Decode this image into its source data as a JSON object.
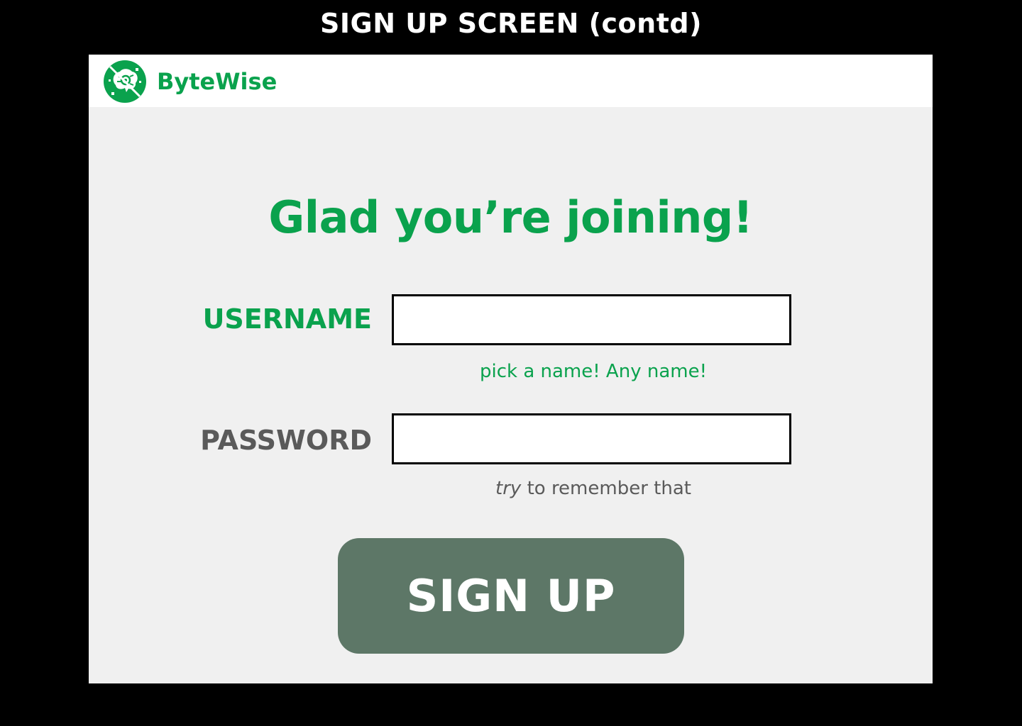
{
  "frame": {
    "title": "SIGN UP SCREEN (contd)"
  },
  "brand": {
    "name": "ByteWise",
    "logo_icon": "brain-chip-logo-icon",
    "color": "#0aa24d"
  },
  "colors": {
    "accent": "#0aa24d",
    "muted_text": "#5a5a5a",
    "button_bg": "#5d7767",
    "app_bg": "#f0f0f0"
  },
  "form": {
    "headline": "Glad you’re joining!",
    "username": {
      "label": "USERNAME",
      "value": "",
      "hint": "pick a name! Any name!"
    },
    "password": {
      "label": "PASSWORD",
      "value": "",
      "hint_emphasis": "try",
      "hint_rest": " to remember that"
    },
    "submit_label": "SIGN UP"
  }
}
